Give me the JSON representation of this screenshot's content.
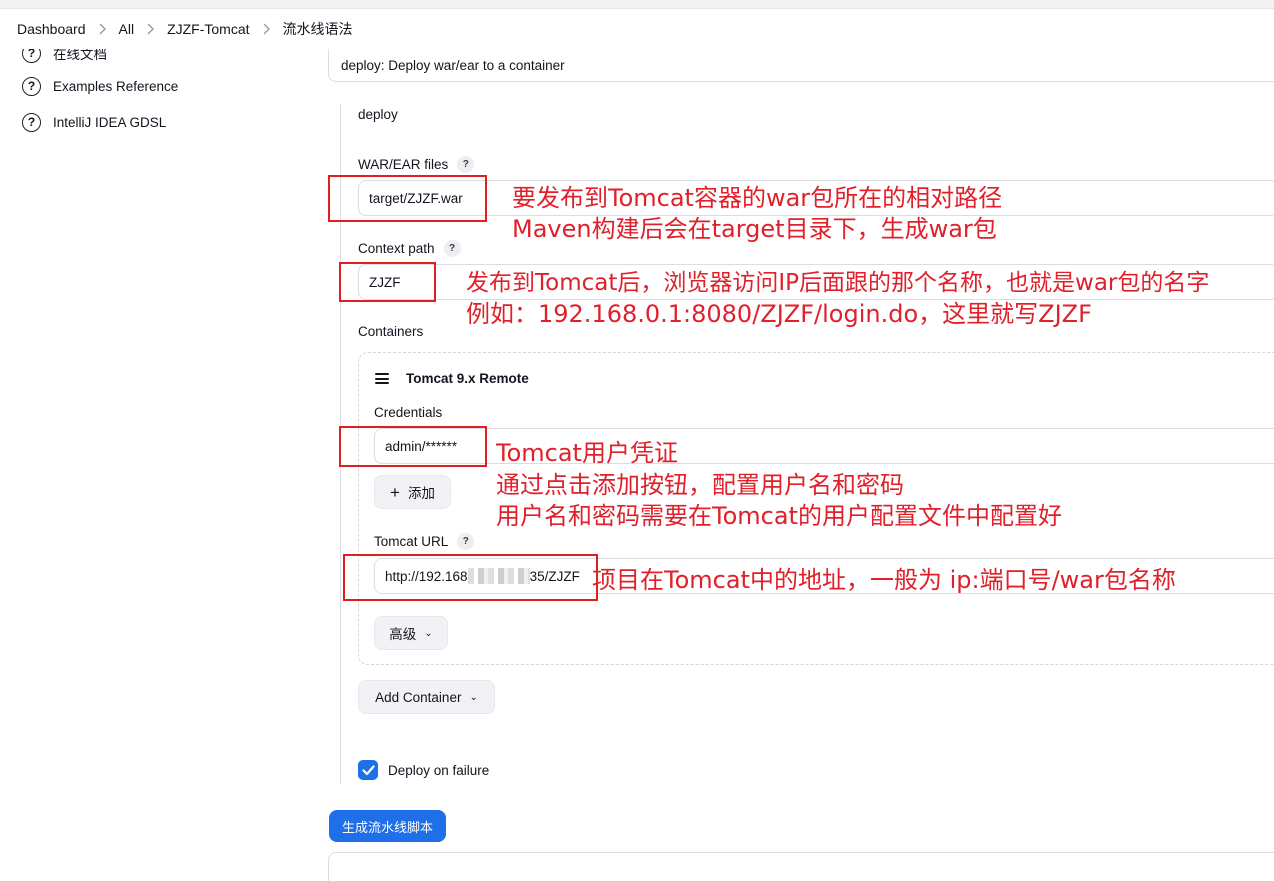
{
  "breadcrumb": [
    "Dashboard",
    "All",
    "ZJZF-Tomcat",
    "流水线语法"
  ],
  "sidebar": {
    "items": [
      {
        "label": "在线文档",
        "icon": "help-circle-icon"
      },
      {
        "label": "Examples Reference",
        "icon": "help-circle-icon"
      },
      {
        "label": "IntelliJ IDEA GDSL",
        "icon": "help-circle-icon"
      }
    ]
  },
  "step": {
    "selected": "deploy: Deploy war/ear to a container"
  },
  "form": {
    "title": "deploy",
    "war_label": "WAR/EAR files",
    "war_value": "target/ZJZF.war",
    "context_label": "Context path",
    "context_value": "ZJZF",
    "containers_label": "Containers",
    "container_title": "Tomcat 9.x Remote",
    "credentials_label": "Credentials",
    "credentials_value": "admin/******",
    "add_label": "添加",
    "tomcat_url_label": "Tomcat URL",
    "tomcat_url_prefix": "http://192.168",
    "tomcat_url_suffix": "35/ZJZF",
    "advanced_label": "高级",
    "add_container_label": "Add Container",
    "deploy_failure_label": "Deploy on failure",
    "deploy_failure_checked": true,
    "generate_label": "生成流水线脚本"
  },
  "annotations": {
    "war_line1": "要发布到Tomcat容器的war包所在的相对路径",
    "war_line2": "Maven构建后会在target目录下，生成war包",
    "ctx_line1": "发布到Tomcat后，浏览器访问IP后面跟的那个名称，也就是war包的名字",
    "ctx_line2": "例如：192.168.0.1:8080/ZJZF/login.do，这里就写ZJZF",
    "cred_line1": "Tomcat用户凭证",
    "cred_line2": "通过点击添加按钮，配置用户名和密码",
    "cred_line3": "用户名和密码需要在Tomcat的用户配置文件中配置好",
    "url_line1": "项目在Tomcat中的地址，一般为 ip:端口号/war包名称"
  },
  "colors": {
    "accent": "#1e6fe8",
    "annotation": "#e0202a"
  }
}
